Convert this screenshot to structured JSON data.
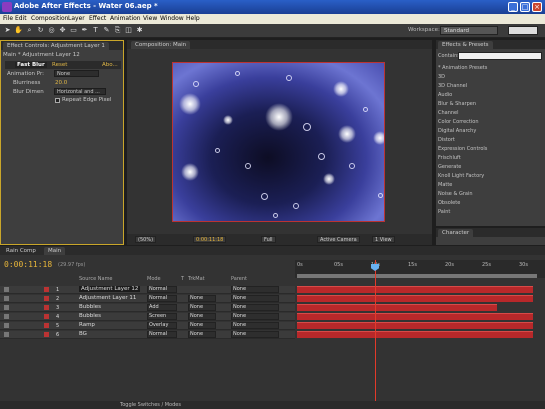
{
  "window": {
    "title": "Adobe After Effects - Water 06.aep *"
  },
  "menu": [
    "File",
    "Edit",
    "Composition",
    "Layer",
    "Effect",
    "Animation",
    "View",
    "Window",
    "Help"
  ],
  "toolbar": {
    "workspace_label": "Workspace:",
    "workspace_value": "Standard"
  },
  "effect_controls": {
    "tab": "Effect Controls: Adjustment Layer 1",
    "subtitle": "Main * Adjustment Layer 12",
    "effect_name": "Fast Blur",
    "reset": "Reset",
    "about": "Abo...",
    "animation_presets_label": "Animation Pr:",
    "animation_presets_value": "None",
    "blurriness_label": "Blurriness",
    "blurriness_value": "20.0",
    "blur_dim_label": "Blur Dimen",
    "blur_dim_value": "Horizontal and ...",
    "repeat_edge": "Repeat Edge Pixel"
  },
  "composition": {
    "tab": "Composition: Main",
    "zoom": "(50%)",
    "timecode": "0:00:11:18",
    "resolution": "Full",
    "camera": "Active Camera",
    "views": "1 View"
  },
  "effects_presets": {
    "tab": "Effects & Presets",
    "contains_label": "Contains:",
    "items": [
      "* Animation Presets",
      "3D",
      "3D Channel",
      "Audio",
      "Blur & Sharpen",
      "Channel",
      "Color Correction",
      "Digital Anarchy",
      "Distort",
      "Expression Controls",
      "Frischluft",
      "Generate",
      "Knoll Light Factory",
      "Matte",
      "Noise & Grain",
      "Obsolete",
      "Paint"
    ]
  },
  "character_panel": {
    "tab": "Character"
  },
  "timeline": {
    "tabs": [
      "Rain Comp",
      "Main"
    ],
    "timecode": "0:00:11:18",
    "fps": "(29.97 fps)",
    "columns": {
      "source": "Source Name",
      "mode": "Mode",
      "t": "T",
      "trkmat": "TrkMat",
      "parent": "Parent"
    },
    "ruler_ticks": [
      "0s",
      "05s",
      "10s",
      "15s",
      "20s",
      "25s",
      "30s"
    ],
    "layers": [
      {
        "num": "1",
        "name": "Adjustment Layer 12",
        "mode": "Normal",
        "trkmat": "",
        "parent": "None"
      },
      {
        "num": "2",
        "name": "Adjustment Layer 11",
        "mode": "Normal",
        "trkmat": "None",
        "parent": "None"
      },
      {
        "num": "3",
        "name": "Bubbles",
        "mode": "Add",
        "trkmat": "None",
        "parent": "None"
      },
      {
        "num": "4",
        "name": "Bubbles",
        "mode": "Screen",
        "trkmat": "None",
        "parent": "None"
      },
      {
        "num": "5",
        "name": "Ramp",
        "mode": "Overlay",
        "trkmat": "None",
        "parent": "None"
      },
      {
        "num": "6",
        "name": "BG",
        "mode": "Normal",
        "trkmat": "None",
        "parent": "None"
      }
    ],
    "toggle_label": "Toggle Switches / Modes"
  },
  "colors": {
    "accent": "#e8b63a",
    "layer_bar": "#b8282a",
    "cti": "#e23a2a"
  }
}
